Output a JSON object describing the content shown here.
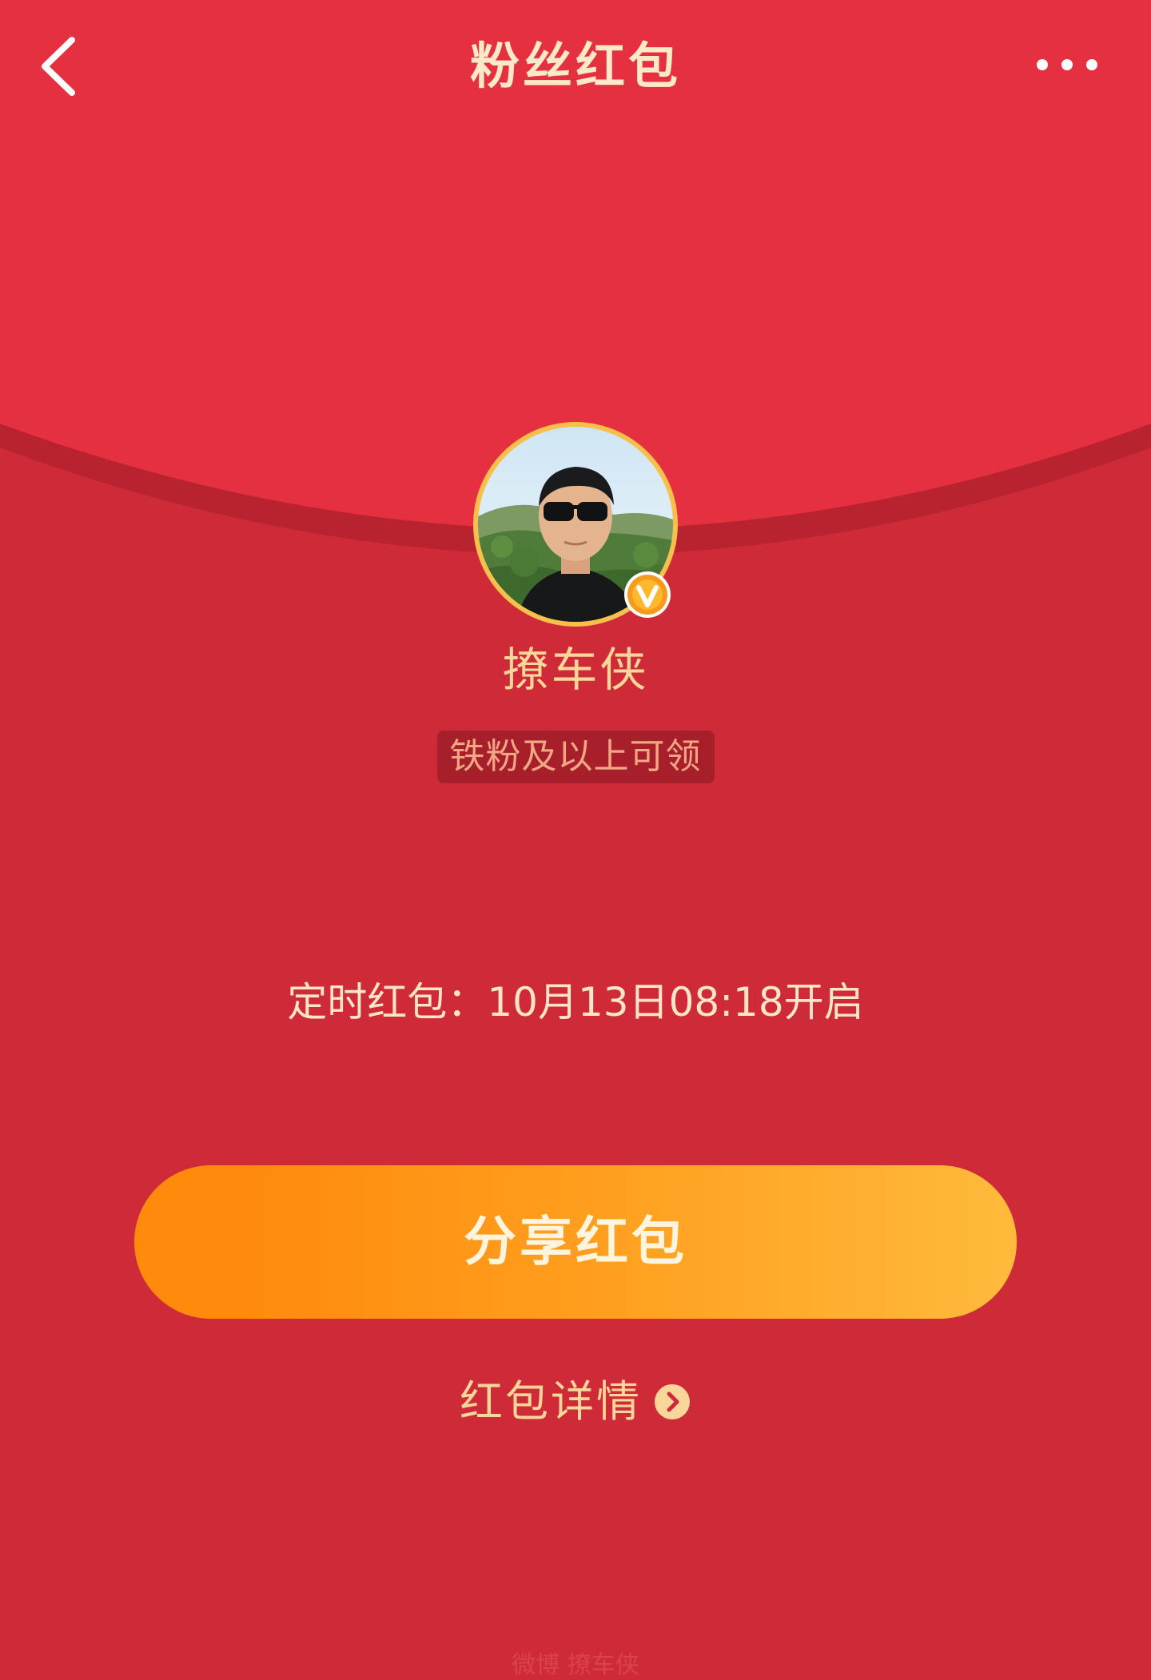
{
  "header": {
    "title": "粉丝红包",
    "back_icon": "chevron-left-icon",
    "more_icon": "more-horizontal-icon"
  },
  "sender": {
    "name": "撩车侠",
    "avatar_badge_icon": "verified-v-icon",
    "eligibility": "铁粉及以上可领"
  },
  "timer": {
    "text": "定时红包：10月13日08:18开启"
  },
  "actions": {
    "share_label": "分享红包",
    "details_label": "红包详情",
    "details_icon": "chevron-right-circle-icon"
  },
  "watermark": "微博 撩车侠",
  "colors": {
    "top_background": "#e5313f",
    "main_background": "#cf2a38",
    "button_start": "#ff8a0c",
    "button_end": "#ffba3c",
    "accent_text": "#fbd69a"
  }
}
